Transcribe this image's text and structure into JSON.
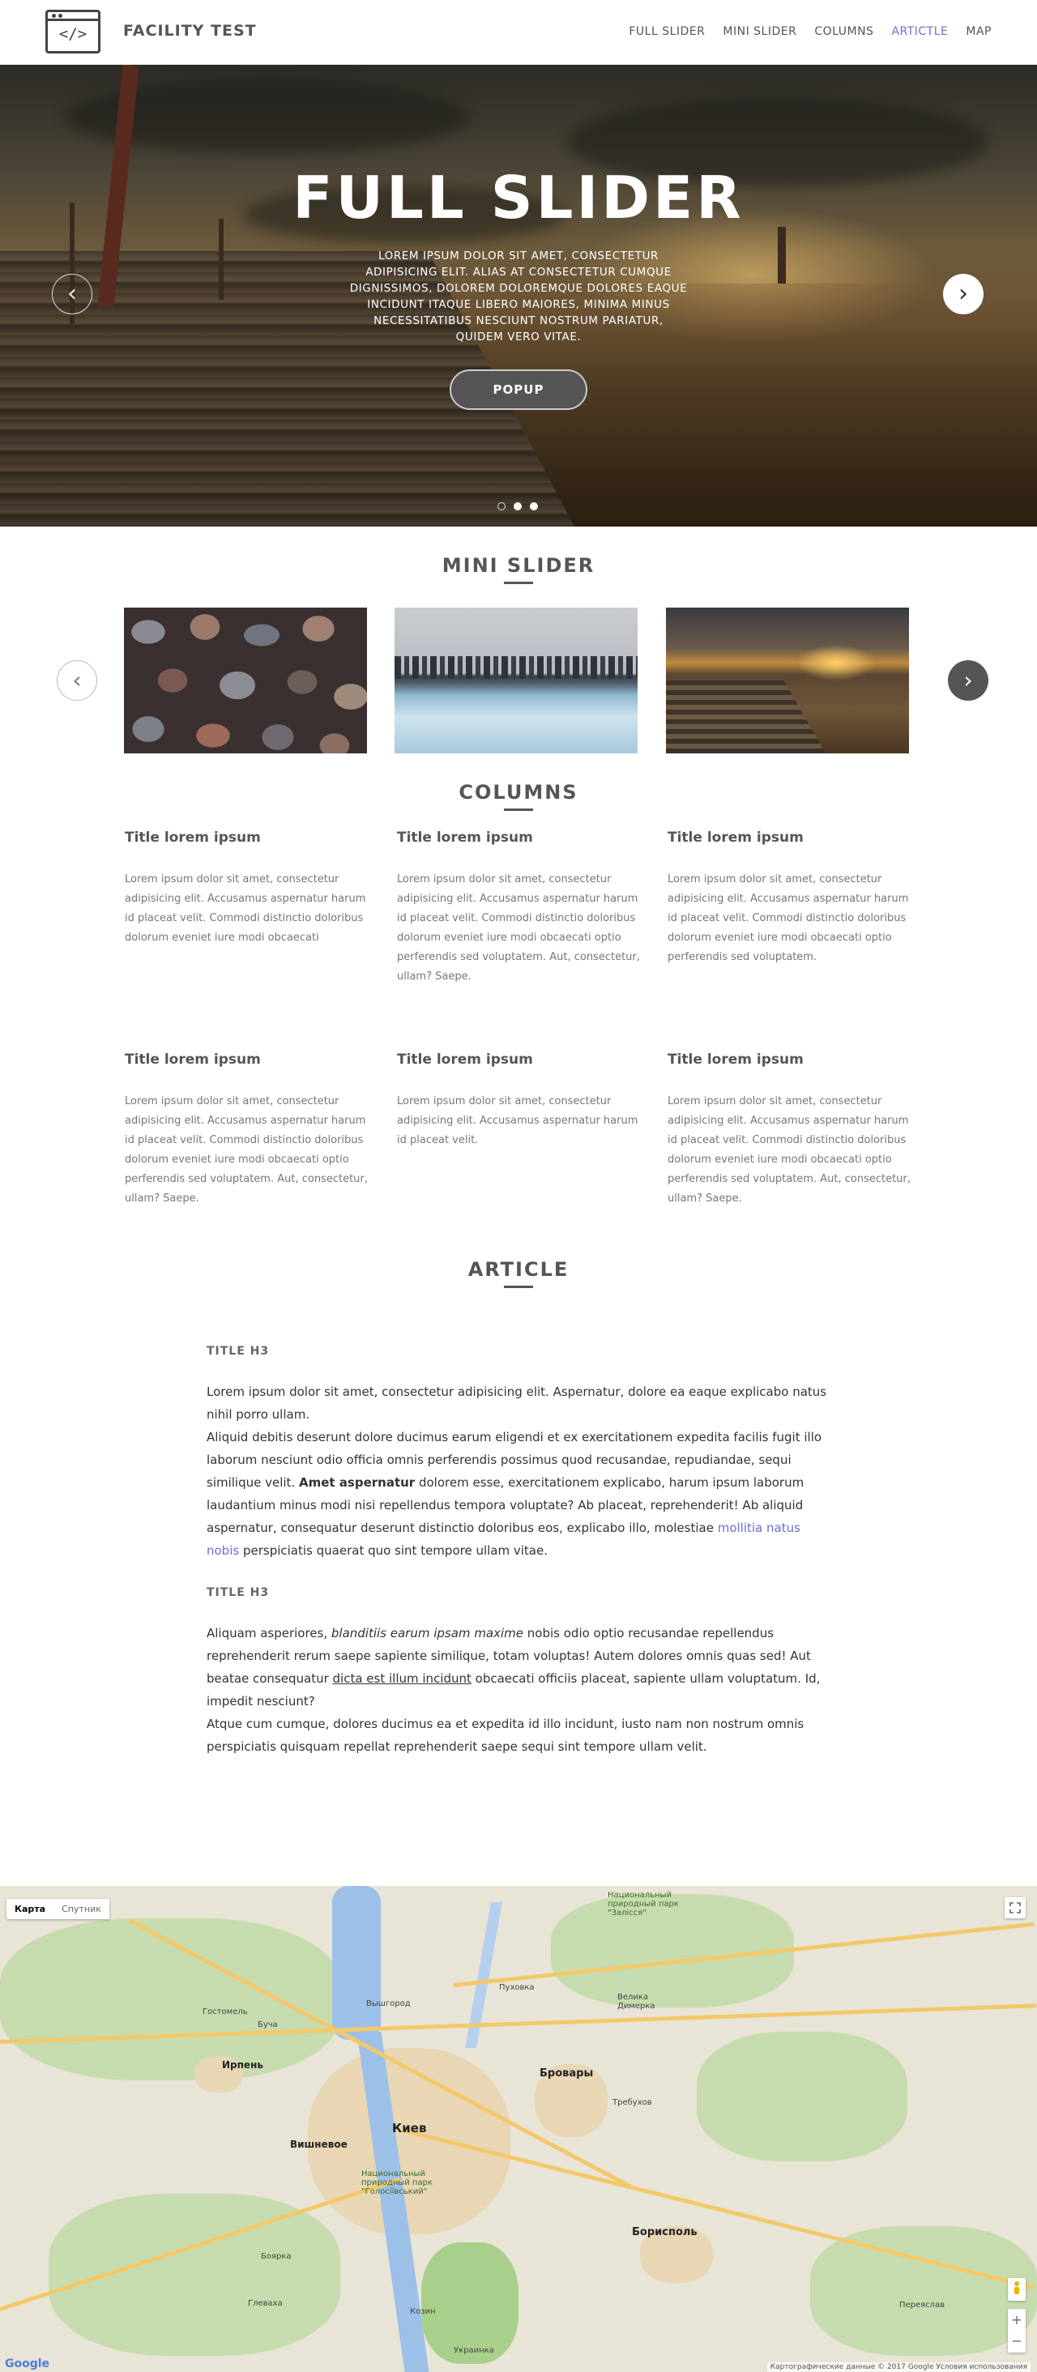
{
  "header": {
    "brand": "FACILITY TEST",
    "logo_text": "</>",
    "nav": [
      "FULL SLIDER",
      "MINI SLIDER",
      "COLUMNS",
      "ARTICTLE",
      "MAP"
    ],
    "active_nav": "ARTICTLE"
  },
  "hero": {
    "title": "FULL SLIDER",
    "text": "LOREM IPSUM DOLOR SIT AMET, CONSECTETUR ADIPISICING ELIT. ALIAS AT CONSECTETUR CUMQUE DIGNISSIMOS, DOLOREM DOLOREMQUE DOLORES EAQUE INCIDUNT ITAQUE LIBERO MAIORES, MINIMA MINUS NECESSITATIBUS NESCIUNT NOSTRUM PARIATUR, QUIDEM VERO VITAE.",
    "button": "POPUP",
    "prev_icon": "‹",
    "next_icon": "›"
  },
  "mini_slider": {
    "title": "MINI SLIDER",
    "prev_icon": "‹",
    "next_icon": "›"
  },
  "columns": {
    "title": "COLUMNS",
    "items": [
      {
        "title": "Title lorem ipsum",
        "text": "Lorem ipsum dolor sit amet, consectetur adipisicing elit. Accusamus aspernatur harum id placeat velit. Commodi distinctio doloribus dolorum eveniet iure modi obcaecati"
      },
      {
        "title": "Title lorem ipsum",
        "text": "Lorem ipsum dolor sit amet, consectetur adipisicing elit. Accusamus aspernatur harum id placeat velit. Commodi distinctio doloribus dolorum eveniet iure modi obcaecati optio perferendis sed voluptatem. Aut, consectetur, ullam? Saepe."
      },
      {
        "title": "Title lorem ipsum",
        "text": "Lorem ipsum dolor sit amet, consectetur adipisicing elit. Accusamus aspernatur harum id placeat velit. Commodi distinctio doloribus dolorum eveniet iure modi obcaecati optio perferendis sed voluptatem."
      },
      {
        "title": "Title lorem ipsum",
        "text": "Lorem ipsum dolor sit amet, consectetur adipisicing elit. Accusamus aspernatur harum id placeat velit. Commodi distinctio doloribus dolorum eveniet iure modi obcaecati optio perferendis sed voluptatem. Aut, consectetur, ullam? Saepe."
      },
      {
        "title": "Title lorem ipsum",
        "text": "Lorem ipsum dolor sit amet, consectetur adipisicing elit. Accusamus aspernatur harum id placeat velit."
      },
      {
        "title": "Title lorem ipsum",
        "text": "Lorem ipsum dolor sit amet, consectetur adipisicing elit. Accusamus aspernatur harum id placeat velit. Commodi distinctio doloribus dolorum eveniet iure modi obcaecati optio perferendis sed voluptatem. Aut, consectetur, ullam? Saepe."
      }
    ]
  },
  "article": {
    "title": "ARTICLE",
    "h3_1": "TITLE H3",
    "p1": "Lorem ipsum dolor sit amet, consectetur adipisicing elit. Aspernatur, dolore ea eaque explicabo natus nihil porro ullam.",
    "p2_a": "Aliquid debitis deserunt dolore ducimus earum eligendi et ex exercitationem expedita facilis fugit illo laborum nesciunt odio officia omnis perferendis possimus quod recusandae, repudiandae, sequi similique velit. ",
    "p2_bold": "Amet aspernatur",
    "p2_b": " dolorem esse, exercitationem explicabo, harum ipsum laborum laudantium minus modi nisi repellendus tempora voluptate? Ab placeat, reprehenderit! Ab aliquid aspernatur, consequatur deserunt distinctio doloribus eos, explicabo illo, molestiae ",
    "p2_link": "mollitia natus nobis",
    "p2_c": " perspiciatis quaerat quo sint tempore ullam vitae.",
    "h3_2": "TITLE H3",
    "p3_a": "Aliquam asperiores, ",
    "p3_italic": "blanditiis earum ipsam maxime",
    "p3_b": " nobis odio optio recusandae repellendus reprehenderit rerum saepe sapiente similique, totam voluptas! Autem dolores omnis quas sed! Aut beatae consequatur ",
    "p3_underline": "dicta est illum incidunt",
    "p3_c": " obcaecati officiis placeat, sapiente ullam voluptatum. Id, impedit nesciunt?",
    "p4": "Atque cum cumque, dolores ducimus ea et expedita id illo incidunt, iusto nam non nostrum omnis perspiciatis quisquam repellat reprehenderit saepe sequi sint tempore ullam velit."
  },
  "map": {
    "type_map": "Карта",
    "type_satellite": "Спутник",
    "zoom_in": "+",
    "zoom_out": "−",
    "footer": "Картографические данные © 2017 Google    Условия использования",
    "google": "Google",
    "labels": {
      "kyiv": "Киев",
      "brovary": "Бровары",
      "boryspil": "Борисполь",
      "irpin": "Ирпень",
      "vyshneve": "Вишневое",
      "park1": "Национальный природный парк \"Залісся\"",
      "park2": "Национальный природный парк \"Голосіївський\"",
      "vyshgorod": "Вышгород",
      "bucha": "Буча",
      "hostomel": "Гостомель",
      "pukhivka": "Пуховка",
      "trebukhiv": "Требухов",
      "velyka_dymerka": "Велика Димерка",
      "boiarka": "Боярка",
      "hlevakha": "Глеваха",
      "ukrainka": "Украинка",
      "kozyn": "Козин",
      "pereyaslav": "Переяслав"
    }
  }
}
